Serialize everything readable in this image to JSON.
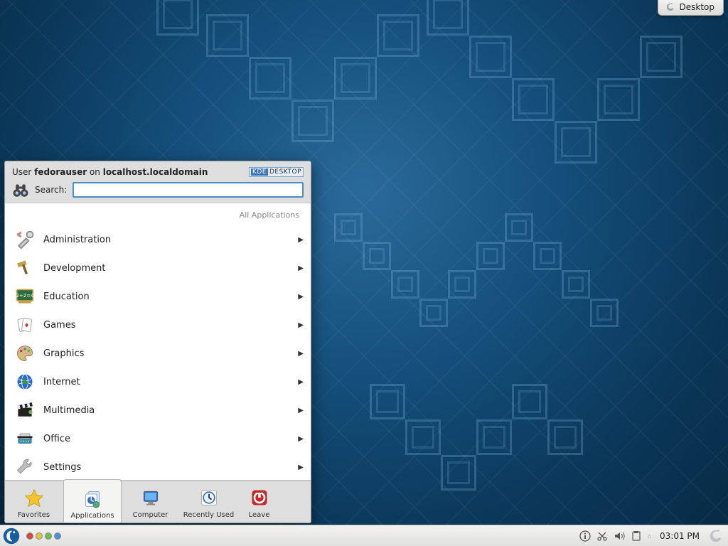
{
  "desktop_toolbox": {
    "label": "Desktop"
  },
  "kickoff": {
    "user_prefix": "User ",
    "user_name": "fedorauser",
    "user_middle": " on ",
    "host": "localhost.localdomain",
    "badge_left": "KDE",
    "badge_right": "DESKTOP",
    "search_label": "Search:",
    "search_value": "",
    "breadcrumb": "All Applications",
    "categories": [
      {
        "label": "Administration",
        "icon": "tools"
      },
      {
        "label": "Development",
        "icon": "hammer"
      },
      {
        "label": "Education",
        "icon": "chalkboard"
      },
      {
        "label": "Games",
        "icon": "cards"
      },
      {
        "label": "Graphics",
        "icon": "palette"
      },
      {
        "label": "Internet",
        "icon": "globe"
      },
      {
        "label": "Multimedia",
        "icon": "clapper"
      },
      {
        "label": "Office",
        "icon": "typewriter"
      },
      {
        "label": "Settings",
        "icon": "wrench"
      }
    ],
    "tabs": [
      {
        "label": "Favorites",
        "icon": "star"
      },
      {
        "label": "Applications",
        "icon": "apps",
        "active": true
      },
      {
        "label": "Computer",
        "icon": "monitor"
      },
      {
        "label": "Recently Used",
        "icon": "clock"
      },
      {
        "label": "Leave",
        "icon": "power"
      }
    ]
  },
  "panel": {
    "clock": "03:01 PM",
    "tray": [
      "info",
      "cut",
      "volume",
      "clipboard",
      "up-arrow"
    ]
  }
}
